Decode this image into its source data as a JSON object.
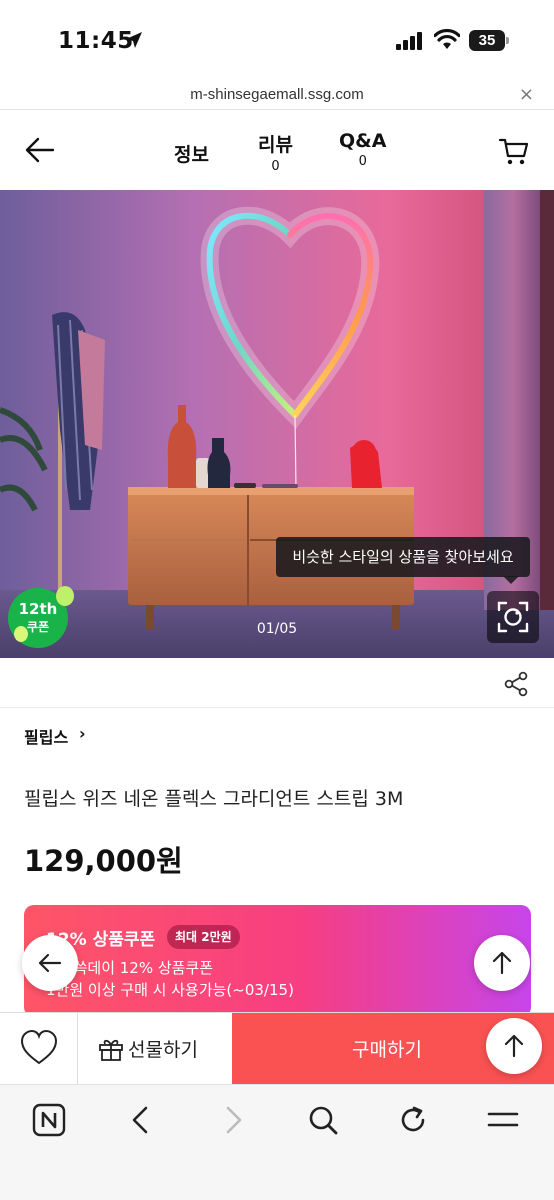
{
  "status_bar": {
    "time": "11:45",
    "battery": "35"
  },
  "url_bar": {
    "url": "m-shinsegaemall.ssg.com",
    "close": "×"
  },
  "nav": {
    "tabs": [
      {
        "label": "정보",
        "count": ""
      },
      {
        "label": "리뷰",
        "count": "0"
      },
      {
        "label": "Q&A",
        "count": "0"
      }
    ]
  },
  "gallery": {
    "tooltip": "비슷한 스타일의 상품을 찾아보세요",
    "page_indicator": "01/05",
    "badge_line1": "12th",
    "badge_line2": "쿠폰"
  },
  "product": {
    "brand": "필립스",
    "brand_chevron": "›",
    "title": "필립스 위즈 네온 플렉스 그라디언트 스트립 3M",
    "price": "129,000원"
  },
  "coupon": {
    "title": "12% 상품쿠폰",
    "badge": "최대 2만원",
    "line1": "쓱버쓱데이 12% 상품쿠폰",
    "line2": "1만원 이상 구매 시 사용가능(~03/15)"
  },
  "actions": {
    "gift_label": "선물하기",
    "buy_label": "구매하기"
  },
  "colors": {
    "accent_red": "#fa5252",
    "coupon_start": "#ff5567",
    "coupon_end": "#c645ea",
    "badge_green": "#19b34a"
  }
}
